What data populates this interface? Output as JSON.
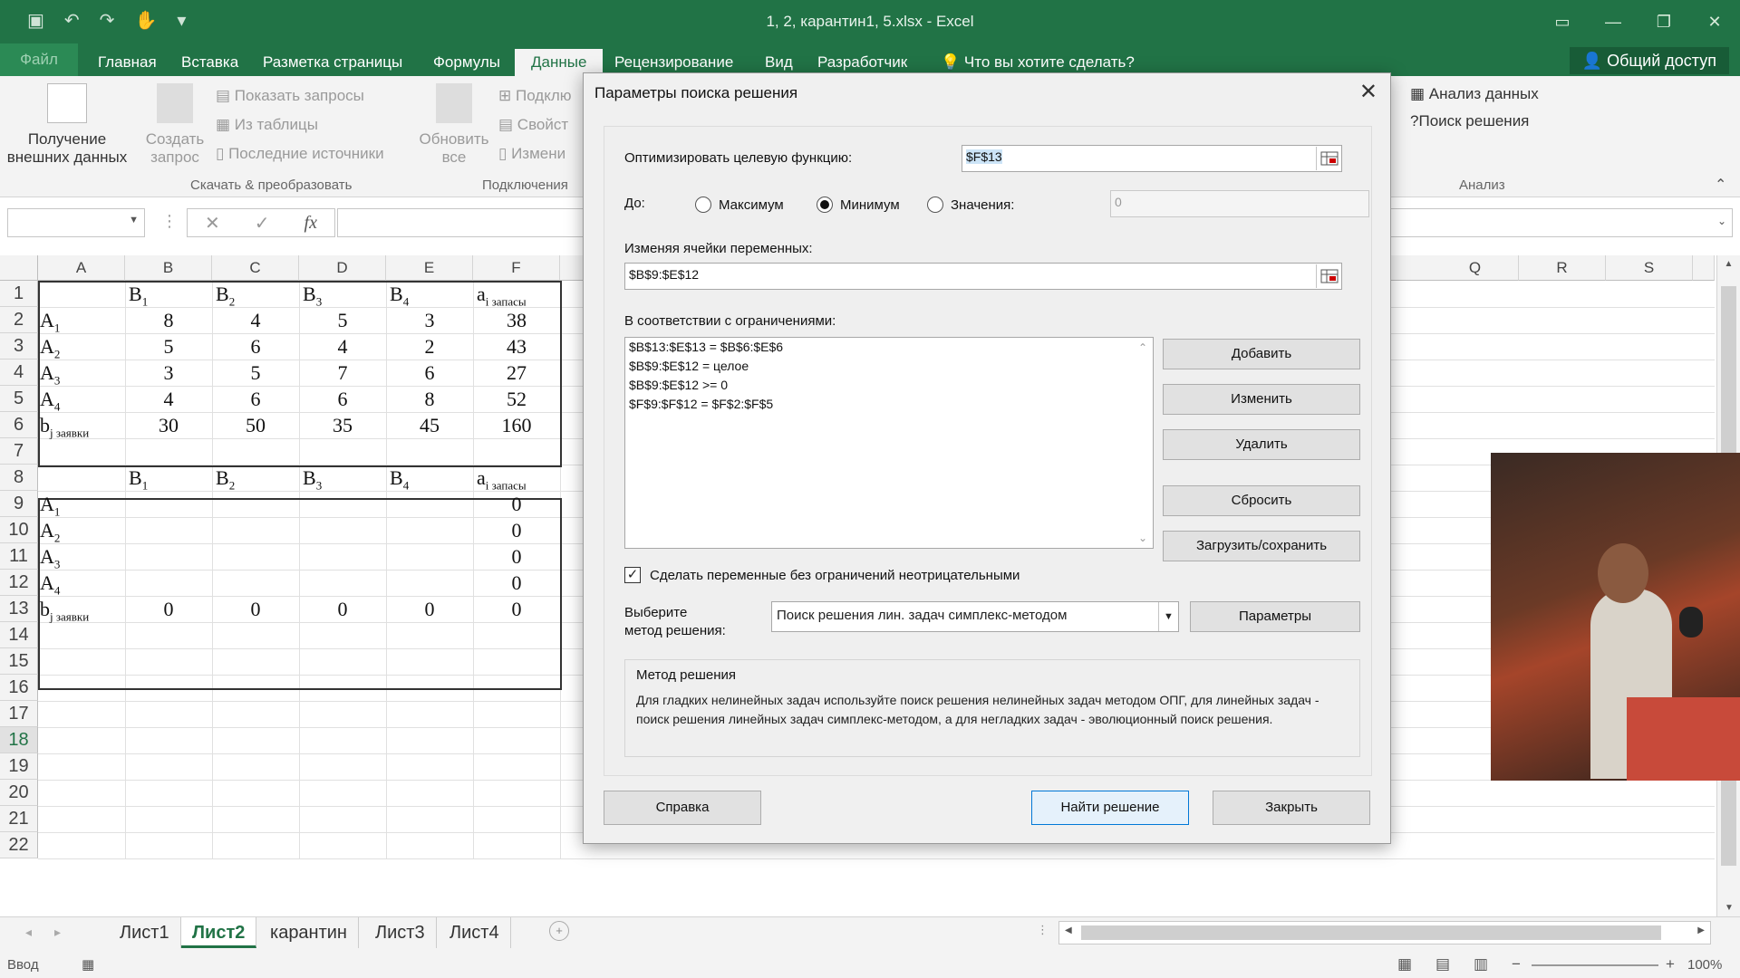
{
  "window": {
    "title": "1, 2, карантин1, 5.xlsx - Excel"
  },
  "ribbon_tabs": [
    "Файл",
    "Главная",
    "Вставка",
    "Разметка страницы",
    "Формулы",
    "Данные",
    "Рецензирование",
    "Вид",
    "Разработчик",
    "Что вы хотите сделать?"
  ],
  "share_label": "Общий доступ",
  "ribbon": {
    "get_external": [
      "Получение",
      "внешних данных"
    ],
    "create_query": [
      "Создать",
      "запрос"
    ],
    "show_queries": "Показать запросы",
    "from_table": "Из таблицы",
    "recent_sources": "Последние источники",
    "group_transform": "Скачать & преобразовать",
    "refresh_all": [
      "Обновить",
      "все"
    ],
    "connections": "Подклю",
    "properties": "Свойст",
    "edit_links": "Измени",
    "group_connections": "Подключения",
    "data_analysis": "Анализ данных",
    "solver": "Поиск решения",
    "group_analysis": "Анализ"
  },
  "sheet": {
    "columns": [
      "A",
      "B",
      "C",
      "D",
      "E",
      "F"
    ],
    "right_columns": [
      "Q",
      "R",
      "S"
    ],
    "rows": [
      "1",
      "2",
      "3",
      "4",
      "5",
      "6",
      "7",
      "8",
      "9",
      "10",
      "11",
      "12",
      "13",
      "14",
      "15",
      "16",
      "17",
      "18",
      "19",
      "20",
      "21",
      "22"
    ],
    "selected_row": "18",
    "table1": {
      "header": [
        "B",
        "B",
        "B",
        "B",
        "a"
      ],
      "header_subs": [
        "1",
        "2",
        "3",
        "4",
        "i запасы"
      ],
      "rows": [
        {
          "label": "A",
          "sub": "1",
          "values": [
            "8",
            "4",
            "5",
            "3",
            "38"
          ]
        },
        {
          "label": "A",
          "sub": "2",
          "values": [
            "5",
            "6",
            "4",
            "2",
            "43"
          ]
        },
        {
          "label": "A",
          "sub": "3",
          "values": [
            "3",
            "5",
            "7",
            "6",
            "27"
          ]
        },
        {
          "label": "A",
          "sub": "4",
          "values": [
            "4",
            "6",
            "6",
            "8",
            "52"
          ]
        },
        {
          "label": "b",
          "sub": "j заявки",
          "values": [
            "30",
            "50",
            "35",
            "45",
            "160"
          ]
        }
      ]
    },
    "table2": {
      "header": [
        "B",
        "B",
        "B",
        "B",
        "a"
      ],
      "header_subs": [
        "1",
        "2",
        "3",
        "4",
        "i запасы"
      ],
      "rows": [
        {
          "label": "A",
          "sub": "1",
          "values": [
            "",
            "",
            "",
            "",
            "0"
          ]
        },
        {
          "label": "A",
          "sub": "2",
          "values": [
            "",
            "",
            "",
            "",
            "0"
          ]
        },
        {
          "label": "A",
          "sub": "3",
          "values": [
            "",
            "",
            "",
            "",
            "0"
          ]
        },
        {
          "label": "A",
          "sub": "4",
          "values": [
            "",
            "",
            "",
            "",
            "0"
          ]
        },
        {
          "label": "b",
          "sub": "j заявки",
          "values": [
            "0",
            "0",
            "0",
            "0",
            "0"
          ]
        }
      ]
    }
  },
  "sheet_tabs": [
    "Лист1",
    "Лист2",
    "карантин",
    "Лист3",
    "Лист4"
  ],
  "active_sheet": "Лист2",
  "status": {
    "mode": "Ввод",
    "zoom": "100%"
  },
  "dialog": {
    "title": "Параметры поиска решения",
    "objective_label": "Оптимизировать целевую функцию:",
    "objective_value": "$F$13",
    "to_label": "До:",
    "opt_max": "Максимум",
    "opt_min": "Минимум",
    "opt_value": "Значения:",
    "value_input": "0",
    "variables_label": "Изменяя ячейки переменных:",
    "variables_value": "$B$9:$E$12",
    "constraints_label": "В соответствии с ограничениями:",
    "constraints": [
      "$B$13:$E$13 = $B$6:$E$6",
      "$B$9:$E$12 = целое",
      "$B$9:$E$12 >= 0",
      "$F$9:$F$12 = $F$2:$F$5"
    ],
    "btn_add": "Добавить",
    "btn_change": "Изменить",
    "btn_delete": "Удалить",
    "btn_reset": "Сбросить",
    "btn_load_save": "Загрузить/сохранить",
    "nonneg_label": "Сделать переменные без ограничений неотрицательными",
    "method_label": [
      "Выберите",
      "метод решения:"
    ],
    "method_value": "Поиск решения лин. задач симплекс-методом",
    "btn_params": "Параметры",
    "method_group": "Метод решения",
    "method_desc": "Для гладких нелинейных задач используйте поиск решения нелинейных задач методом ОПГ, для линейных задач - поиск решения линейных задач симплекс-методом, а для негладких задач - эволюционный поиск решения.",
    "btn_help": "Справка",
    "btn_solve": "Найти решение",
    "btn_close": "Закрыть"
  },
  "colors": {
    "excel_green": "#217346",
    "accent_blue": "#0078d7"
  }
}
